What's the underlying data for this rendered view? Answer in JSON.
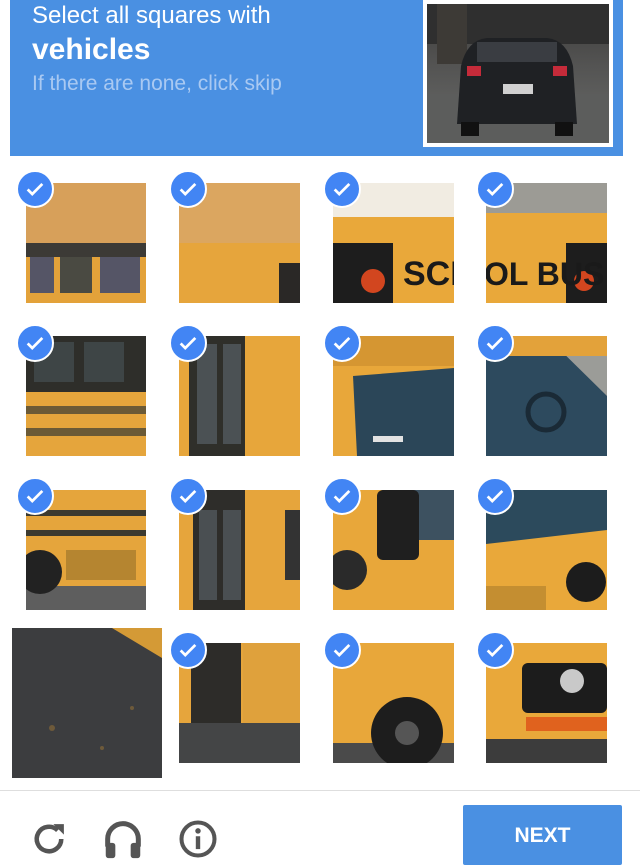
{
  "header": {
    "instruction": "Select all squares with",
    "target": "vehicles",
    "hint": "If there are none, click skip"
  },
  "sample_image": "rear view of a dark car",
  "grid": {
    "rows": 4,
    "columns": 4,
    "tiles": [
      {
        "row": 1,
        "col": 1,
        "selected": true
      },
      {
        "row": 1,
        "col": 2,
        "selected": true
      },
      {
        "row": 1,
        "col": 3,
        "selected": true,
        "text": "SCHO"
      },
      {
        "row": 1,
        "col": 4,
        "selected": true,
        "text": "OL BUS"
      },
      {
        "row": 2,
        "col": 1,
        "selected": true
      },
      {
        "row": 2,
        "col": 2,
        "selected": true
      },
      {
        "row": 2,
        "col": 3,
        "selected": true
      },
      {
        "row": 2,
        "col": 4,
        "selected": true
      },
      {
        "row": 3,
        "col": 1,
        "selected": true
      },
      {
        "row": 3,
        "col": 2,
        "selected": true
      },
      {
        "row": 3,
        "col": 3,
        "selected": true
      },
      {
        "row": 3,
        "col": 4,
        "selected": true
      },
      {
        "row": 4,
        "col": 1,
        "selected": false
      },
      {
        "row": 4,
        "col": 2,
        "selected": true
      },
      {
        "row": 4,
        "col": 3,
        "selected": true
      },
      {
        "row": 4,
        "col": 4,
        "selected": true
      }
    ]
  },
  "footer": {
    "icons": [
      "reload-icon",
      "audio-icon",
      "info-icon"
    ],
    "next_label": "NEXT"
  },
  "colors": {
    "accent": "#4a90e2",
    "check": "#4285f4",
    "bus_yellow": "#e9a83a"
  }
}
